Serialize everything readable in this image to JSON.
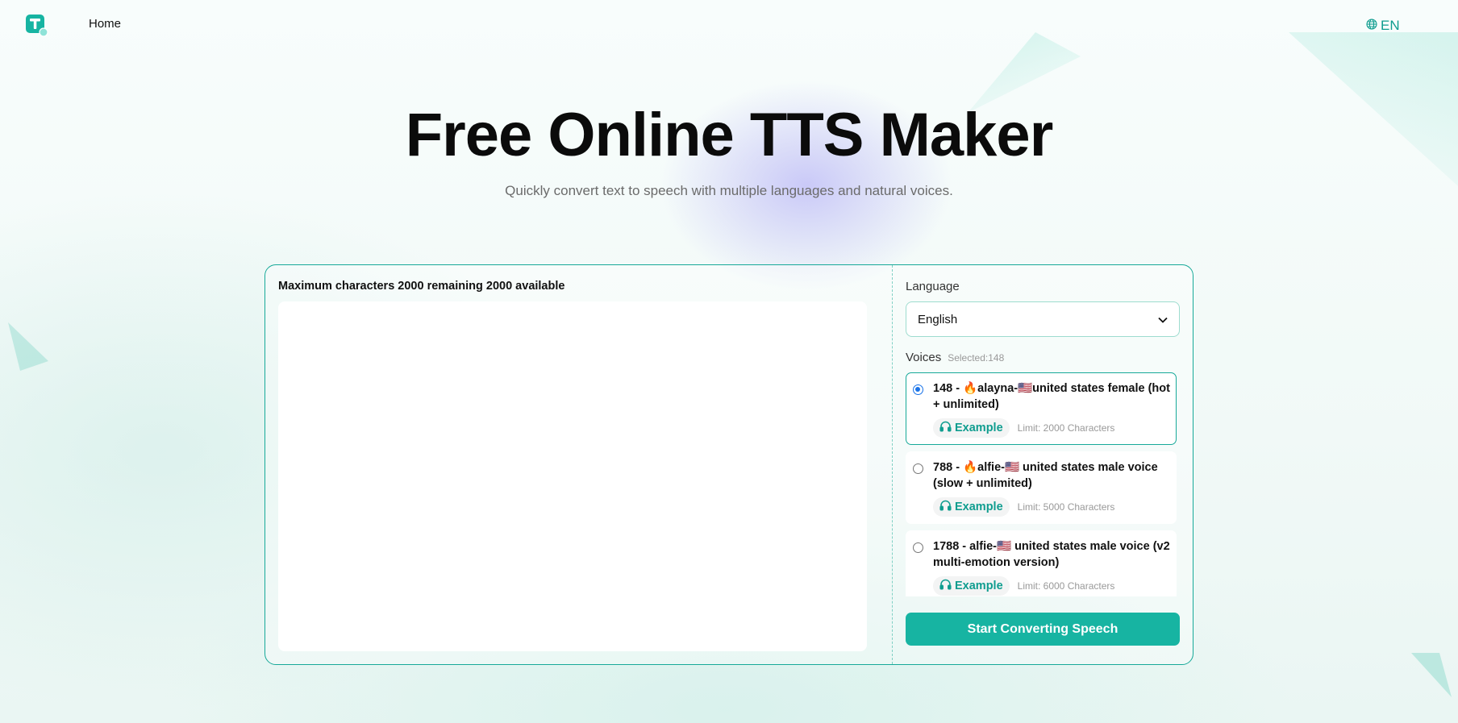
{
  "header": {
    "nav_home": "Home",
    "lang_code": "EN"
  },
  "hero": {
    "title": "Free Online TTS Maker",
    "subtitle": "Quickly convert text to speech with multiple languages and natural voices."
  },
  "editor": {
    "max_chars_text": "Maximum characters 2000 remaining 2000 available",
    "text_value": ""
  },
  "settings": {
    "language_label": "Language",
    "language_selected": "English",
    "voices_label": "Voices",
    "voices_selected": "Selected:148",
    "voices": [
      {
        "name": "148 - 🔥alayna-🇺🇸united states female (hot + unlimited)",
        "example_label": "Example",
        "limit": "Limit: 2000 Characters",
        "selected": true
      },
      {
        "name": "788 - 🔥alfie-🇺🇸 united states male voice (slow + unlimited)",
        "example_label": "Example",
        "limit": "Limit: 5000 Characters",
        "selected": false
      },
      {
        "name": "1788 - alfie-🇺🇸 united states male voice (v2 multi-emotion version)",
        "example_label": "Example",
        "limit": "Limit: 6000 Characters",
        "selected": false
      }
    ],
    "convert_button": "Start Converting Speech"
  },
  "colors": {
    "accent": "#17b4a2",
    "accent_dark": "#0f9d8f",
    "radio_selected": "#1a73e8"
  }
}
